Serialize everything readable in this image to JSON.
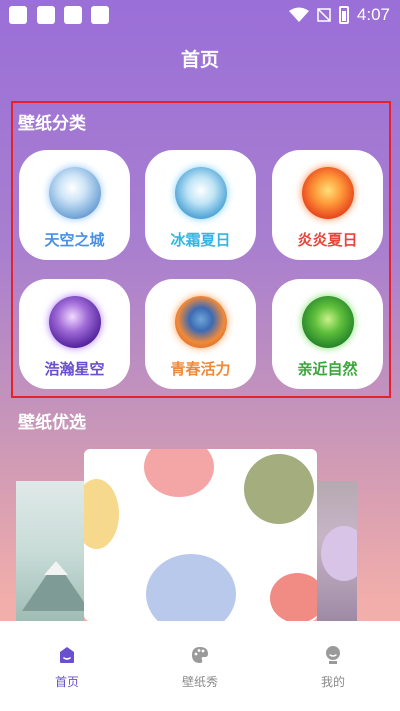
{
  "page": {
    "title": "首页"
  },
  "status_bar": {
    "time": "4:07"
  },
  "categories_section": {
    "label": "壁纸分类",
    "items": [
      {
        "label": "天空之城",
        "color": "#4a90e2",
        "icon": "sky-city-orb-icon"
      },
      {
        "label": "冰霜夏日",
        "color": "#34b6e4",
        "icon": "frost-summer-orb-icon"
      },
      {
        "label": "炎炎夏日",
        "color": "#e8443a",
        "icon": "blazing-summer-orb-icon"
      },
      {
        "label": "浩瀚星空",
        "color": "#6a4fd0",
        "icon": "starry-sky-orb-icon"
      },
      {
        "label": "青春活力",
        "color": "#f08a3a",
        "icon": "youth-vitality-orb-icon"
      },
      {
        "label": "亲近自然",
        "color": "#3aa63a",
        "icon": "nature-orb-icon"
      }
    ]
  },
  "featured_section": {
    "label": "壁纸优选"
  },
  "bottom_nav": {
    "items": [
      {
        "label": "首页",
        "icon": "home-icon",
        "active": true
      },
      {
        "label": "壁纸秀",
        "icon": "palette-icon",
        "active": false
      },
      {
        "label": "我的",
        "icon": "profile-icon",
        "active": false
      }
    ],
    "active_color": "#6a4fd0",
    "inactive_color": "#8a8a8a"
  }
}
